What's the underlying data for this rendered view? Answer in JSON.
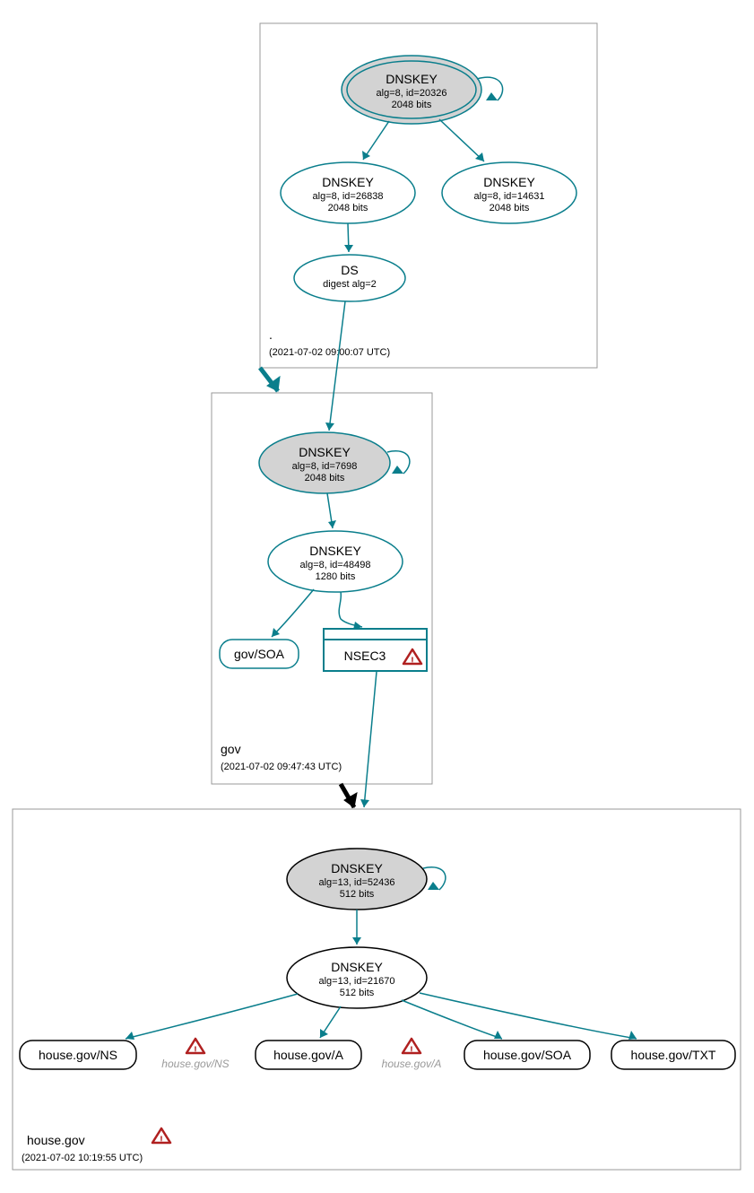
{
  "zones": {
    "root": {
      "label": ".",
      "timestamp": "(2021-07-02 09:00:07 UTC)",
      "nodes": {
        "ksk": {
          "title": "DNSKEY",
          "alg": "alg=8, id=20326",
          "bits": "2048 bits"
        },
        "zsk1": {
          "title": "DNSKEY",
          "alg": "alg=8, id=26838",
          "bits": "2048 bits"
        },
        "zsk2": {
          "title": "DNSKEY",
          "alg": "alg=8, id=14631",
          "bits": "2048 bits"
        },
        "ds": {
          "title": "DS",
          "sub": "digest alg=2"
        }
      }
    },
    "gov": {
      "label": "gov",
      "timestamp": "(2021-07-02 09:47:43 UTC)",
      "nodes": {
        "ksk": {
          "title": "DNSKEY",
          "alg": "alg=8, id=7698",
          "bits": "2048 bits"
        },
        "zsk": {
          "title": "DNSKEY",
          "alg": "alg=8, id=48498",
          "bits": "1280 bits"
        },
        "soa": {
          "label": "gov/SOA"
        },
        "nsec3": {
          "label": "NSEC3"
        }
      }
    },
    "house": {
      "label": "house.gov",
      "timestamp": "(2021-07-02 10:19:55 UTC)",
      "nodes": {
        "ksk": {
          "title": "DNSKEY",
          "alg": "alg=13, id=52436",
          "bits": "512 bits"
        },
        "zsk": {
          "title": "DNSKEY",
          "alg": "alg=13, id=21670",
          "bits": "512 bits"
        },
        "ns": {
          "label": "house.gov/NS"
        },
        "a": {
          "label": "house.gov/A"
        },
        "soa": {
          "label": "house.gov/SOA"
        },
        "txt": {
          "label": "house.gov/TXT"
        },
        "ghost_ns": {
          "label": "house.gov/NS"
        },
        "ghost_a": {
          "label": "house.gov/A"
        }
      }
    }
  }
}
